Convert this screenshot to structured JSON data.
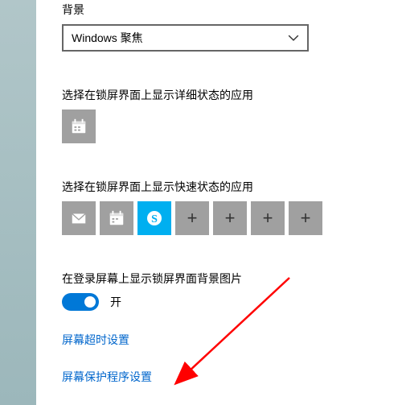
{
  "background": {
    "label": "背景",
    "dropdown_value": "Windows 聚焦"
  },
  "detailed_status": {
    "label": "选择在锁屏界面上显示详细状态的应用",
    "slots": [
      {
        "icon": "calendar"
      }
    ]
  },
  "quick_status": {
    "label": "选择在锁屏界面上显示快速状态的应用",
    "slots": [
      {
        "icon": "mail"
      },
      {
        "icon": "calendar"
      },
      {
        "icon": "skype"
      },
      {
        "icon": "plus"
      },
      {
        "icon": "plus"
      },
      {
        "icon": "plus"
      },
      {
        "icon": "plus"
      }
    ]
  },
  "signin_bg": {
    "label": "在登录屏幕上显示锁屏界面背景图片",
    "toggle_on": true,
    "toggle_text": "开"
  },
  "links": {
    "timeout": "屏幕超时设置",
    "screensaver": "屏幕保护程序设置"
  },
  "colors": {
    "accent": "#0078d7",
    "link": "#0066cc",
    "tile": "#a0a0a0",
    "skype": "#00aff0"
  }
}
